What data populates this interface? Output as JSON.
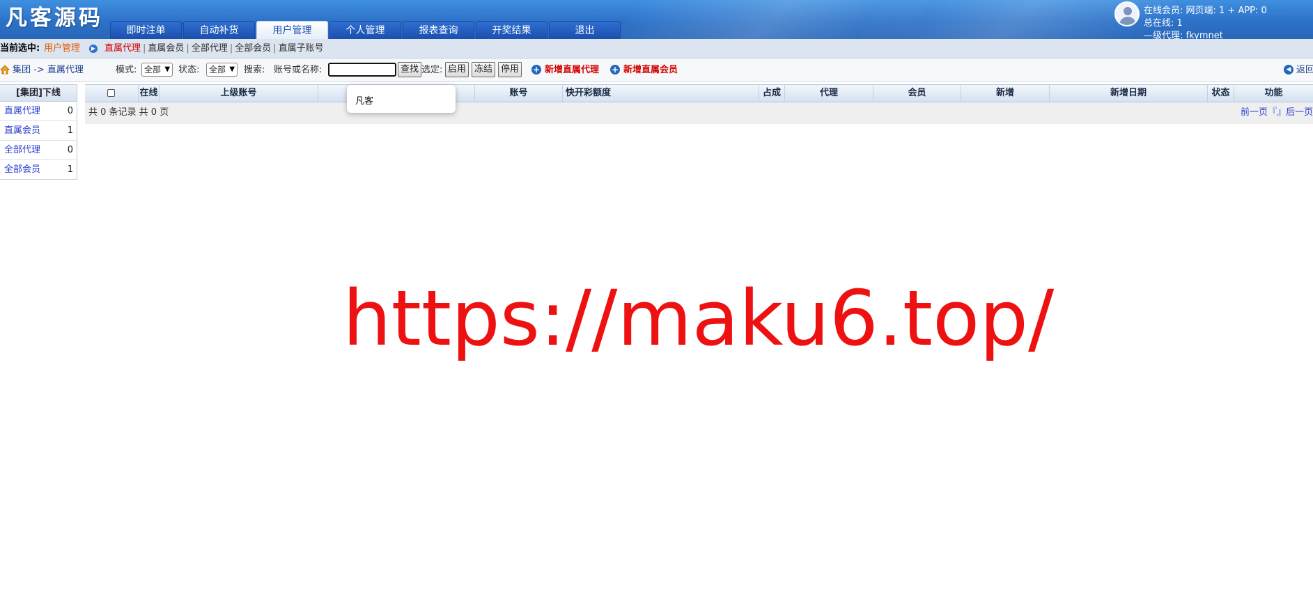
{
  "header": {
    "logo": "凡客源码",
    "tabs": [
      {
        "label": "即时注单"
      },
      {
        "label": "自动补货"
      },
      {
        "label": "用户管理",
        "active": true
      },
      {
        "label": "个人管理"
      },
      {
        "label": "报表查询"
      },
      {
        "label": "开奖结果"
      },
      {
        "label": "退出"
      }
    ],
    "user": {
      "line1": "在线会员:  网页端: 1 + APP: 0",
      "line2": "总在线: 1",
      "line3": "—级代理: fkymnet"
    }
  },
  "crumb": {
    "label": "当前选中:",
    "current": "用户管理",
    "links": [
      "直属代理",
      "直属会员",
      "全部代理",
      "全部会员",
      "直属子账号"
    ],
    "selected_index": 0
  },
  "toolbar": {
    "path": "集团 -> 直属代理",
    "mode_label": "模式:",
    "mode_value": "全部",
    "status_label": "状态:",
    "status_value": "全部",
    "search_label": "搜索:",
    "search_field_label": "账号或名称:",
    "search_value": "",
    "search_button": "查找",
    "select_label": "选定:",
    "enable_button": "启用",
    "freeze_button": "冻结",
    "disable_button": "停用",
    "add_agent": "新增直属代理",
    "add_member": "新增直属会员",
    "back": "返回"
  },
  "sidebar": {
    "title": "[集团]下线",
    "items": [
      {
        "label": "直属代理",
        "count": "0"
      },
      {
        "label": "直属会员",
        "count": "1"
      },
      {
        "label": "全部代理",
        "count": "0"
      },
      {
        "label": "全部会员",
        "count": "1"
      }
    ]
  },
  "grid": {
    "columns": [
      "在线",
      "上级账号",
      "",
      "账号",
      "快开彩额度",
      "占成",
      "代理",
      "会员",
      "新增",
      "新增日期",
      "状态",
      "功能"
    ],
    "records_text": "共 0 条记录 共 0 页",
    "pager_text": "前一页『』后一页"
  },
  "autocomplete": {
    "options": [
      "凡客"
    ]
  },
  "watermark": "https://maku6.top/",
  "colors": {
    "header_blue": "#2d72c8",
    "accent_red": "#d40000",
    "link_blue": "#2a3fd0"
  }
}
